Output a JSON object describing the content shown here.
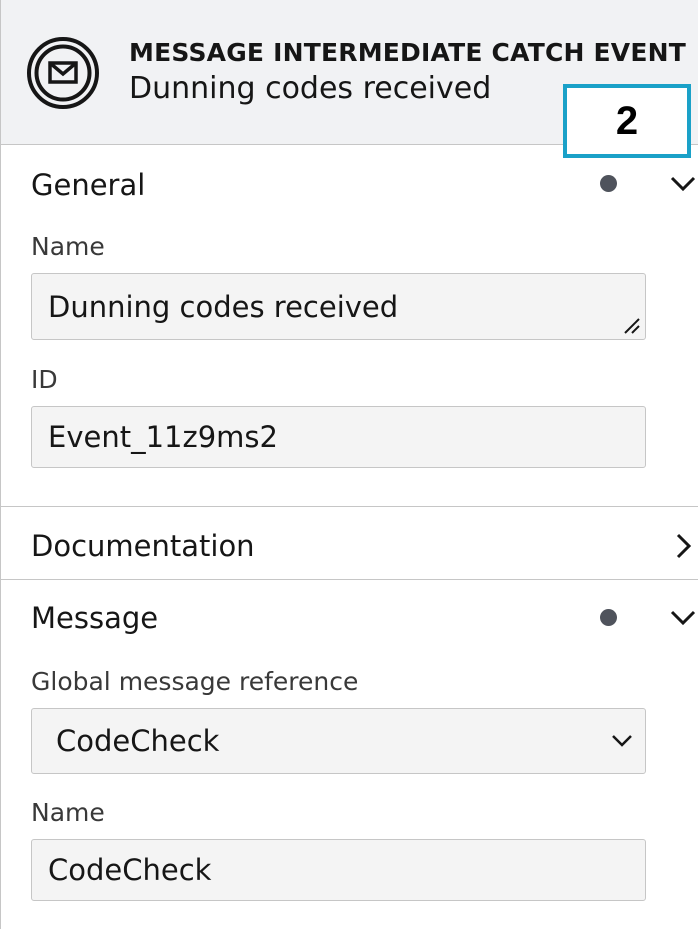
{
  "header": {
    "element_type": "MESSAGE INTERMEDIATE CATCH EVENT",
    "element_name": "Dunning codes received",
    "icon": "envelope-icon"
  },
  "callout_badge": "2",
  "general": {
    "title": "General",
    "name_label": "Name",
    "name_value": "Dunning codes received",
    "id_label": "ID",
    "id_value": "Event_11z9ms2"
  },
  "documentation": {
    "title": "Documentation"
  },
  "message": {
    "title": "Message",
    "reference_label": "Global message reference",
    "reference_value": "CodeCheck",
    "name_label": "Name",
    "name_value": "CodeCheck"
  },
  "colors": {
    "header_bg": "#f1f2f4",
    "badge_border": "#1aa1c8",
    "dot": "#4f535c",
    "field_bg": "#f4f4f4"
  }
}
